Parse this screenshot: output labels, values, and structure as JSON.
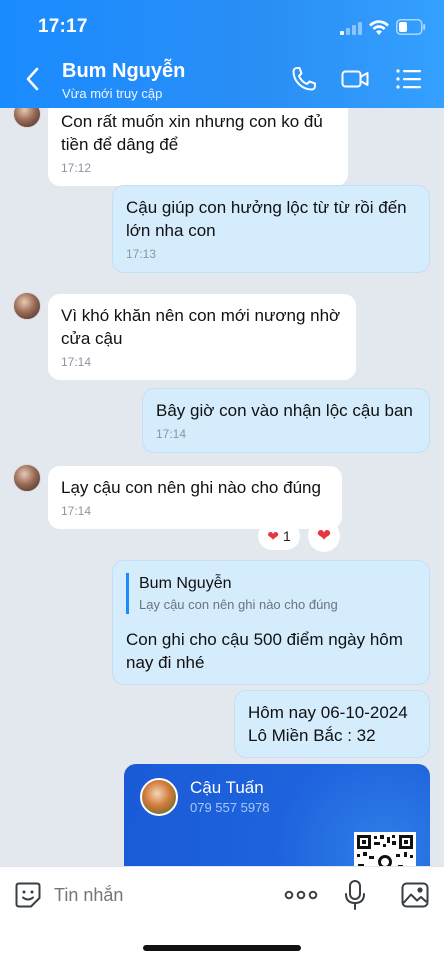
{
  "status_bar": {
    "time": "17:17"
  },
  "header": {
    "contact_name": "Bum Nguyễn",
    "contact_status": "Vừa mới truy cập",
    "icons": {
      "back": "chevron-left-icon",
      "call": "phone-icon",
      "video": "video-call-icon",
      "menu": "list-menu-icon"
    },
    "colors": {
      "header_bg": "#1a8bff"
    }
  },
  "messages": [
    {
      "from": "contact",
      "text_line1": "Con rất muốn xin nhưng con ko đủ",
      "text_line2": "tiền để dâng để",
      "time": "17:12"
    },
    {
      "from": "me",
      "text_line1": "Cậu giúp con hưởng lộc từ từ rồi đến",
      "text_line2": "lớn nha con",
      "time": "17:13"
    },
    {
      "from": "contact",
      "text_line1": "Vì khó khăn nên con mới nương nhờ",
      "text_line2": "cửa cậu",
      "time": "17:14"
    },
    {
      "from": "me",
      "text": "Bây giờ con vào nhận lộc cậu ban",
      "time": "17:14"
    },
    {
      "from": "contact",
      "text": "Lạy cậu con nên ghi nào cho đúng",
      "time": "17:14",
      "reaction_count": "1"
    },
    {
      "from": "me",
      "reply_to_name": "Bum Nguyễn",
      "reply_to_text": "Lạy cậu con nên ghi nào cho đúng",
      "text_line1": "Con ghi cho cậu 500 điểm ngày hôm",
      "text_line2": "nay đi nhé"
    },
    {
      "from": "me",
      "text_line1": "Hôm nay 06-10-2024",
      "text_line2": "Lô Miền Bắc : 32"
    }
  ],
  "contact_card": {
    "name": "Cậu Tuấn",
    "phone": "079 557 5978"
  },
  "composer": {
    "placeholder": "Tin nhắn"
  }
}
